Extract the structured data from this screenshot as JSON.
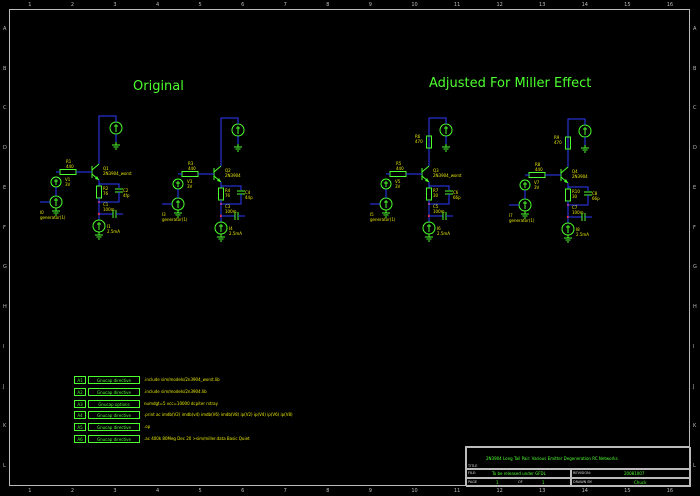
{
  "titles": {
    "left": "Original",
    "right": "Adjusted For Miller Effect"
  },
  "ruler_x": [
    "1",
    "2",
    "3",
    "4",
    "5",
    "6",
    "7",
    "8",
    "9",
    "10",
    "11",
    "12",
    "13",
    "14",
    "15",
    "16"
  ],
  "ruler_y": [
    "A",
    "B",
    "C",
    "D",
    "E",
    "F",
    "G",
    "H",
    "I",
    "J",
    "K",
    "L"
  ],
  "circuits": [
    {
      "transistor": {
        "ref": "Q1",
        "model": "2N3904_worst"
      },
      "vcc": {
        "ref": "V2",
        "value": "12V"
      },
      "r_base": {
        "ref": "R1",
        "value": "440"
      },
      "v_base": {
        "ref": "V1",
        "value": "3V"
      },
      "r_emitter": {
        "ref": "R2",
        "value": "76"
      },
      "c_emitter": {
        "ref": "C2",
        "value": "4fp"
      },
      "c_coupling": {
        "ref": "C1",
        "value": "100m"
      },
      "current_source": {
        "ref": "I1",
        "value": "2.5mA"
      },
      "generator": {
        "ref": "I0",
        "value": "generator(1)"
      },
      "r_collector": null
    },
    {
      "transistor": {
        "ref": "Q2",
        "model": "2N3904"
      },
      "vcc": {
        "ref": "V4",
        "value": "12V"
      },
      "r_base": {
        "ref": "R3",
        "value": "440"
      },
      "v_base": {
        "ref": "V3",
        "value": "3V"
      },
      "r_emitter": {
        "ref": "R4",
        "value": "76"
      },
      "c_emitter": {
        "ref": "C4",
        "value": "44p"
      },
      "c_coupling": {
        "ref": "C3",
        "value": "100m"
      },
      "current_source": {
        "ref": "I4",
        "value": "2.5mA"
      },
      "generator": {
        "ref": "I3",
        "value": "generator(1)"
      },
      "r_collector": null
    },
    {
      "transistor": {
        "ref": "Q3",
        "model": "2N3904_worst"
      },
      "vcc": {
        "ref": "V6",
        "value": "12V"
      },
      "r_base": {
        "ref": "R5",
        "value": "440"
      },
      "v_base": {
        "ref": "V5",
        "value": "3V"
      },
      "r_emitter": {
        "ref": "R7",
        "value": "30"
      },
      "c_emitter": {
        "ref": "C6",
        "value": "66p"
      },
      "c_coupling": {
        "ref": "C5",
        "value": "100m"
      },
      "current_source": {
        "ref": "I6",
        "value": "2.5mA"
      },
      "generator": {
        "ref": "I5",
        "value": "generator(1)"
      },
      "r_collector": {
        "ref": "R6",
        "value": "470"
      }
    },
    {
      "transistor": {
        "ref": "Q4",
        "model": "2N3904"
      },
      "vcc": {
        "ref": "V8",
        "value": "12V"
      },
      "r_base": {
        "ref": "R8",
        "value": "440"
      },
      "v_base": {
        "ref": "V7",
        "value": "3V"
      },
      "r_emitter": {
        "ref": "R10",
        "value": "30"
      },
      "c_emitter": {
        "ref": "C8",
        "value": "66p"
      },
      "c_coupling": {
        "ref": "C7",
        "value": "100m"
      },
      "current_source": {
        "ref": "I8",
        "value": "2.5mA"
      },
      "generator": {
        "ref": "I7",
        "value": "generator(1)"
      },
      "r_collector": {
        "ref": "R9",
        "value": "470"
      }
    }
  ],
  "directives": [
    {
      "id": "A1",
      "name": "Gnucap directive",
      "text": ".include sim/models/2n3904_worst.lib"
    },
    {
      "id": "A2",
      "name": "Gnucap directive",
      "text": ".include sim/models/2n3904.lib"
    },
    {
      "id": "A3",
      "name": "Gnucap options",
      "text": "numdgt=5 vcc=10000 dcpiter rstray"
    },
    {
      "id": "A4",
      "name": "Gnucap directive",
      "text": ".print ac imdb(V2) imdb(v4) imdb(V6) imdb(V8) ip(V2) ip(V4) ip(V6) ip(V8)"
    },
    {
      "id": "A5",
      "name": "Gnucap directive",
      "text": ".op"
    },
    {
      "id": "A6",
      "name": "Gnucap directive",
      "text": ".ac 400k 80Meg Dec 20 >sim/miller.data Basic Quiet"
    }
  ],
  "title_block": {
    "schematic_title": "2N3904 Long Tail Pair: Various Emitter Degeneration RC Networks",
    "title_label": "TITLE",
    "file_label": "FILE:",
    "file_value": "To be released under GFDL",
    "revision_label": "REVISION:",
    "revision_value": "20081007",
    "page_label": "PAGE",
    "page_value": "1",
    "of_label": "OF",
    "of_value": "1",
    "drawn_label": "DRAWN BY:",
    "drawn_value": "Chuck"
  }
}
